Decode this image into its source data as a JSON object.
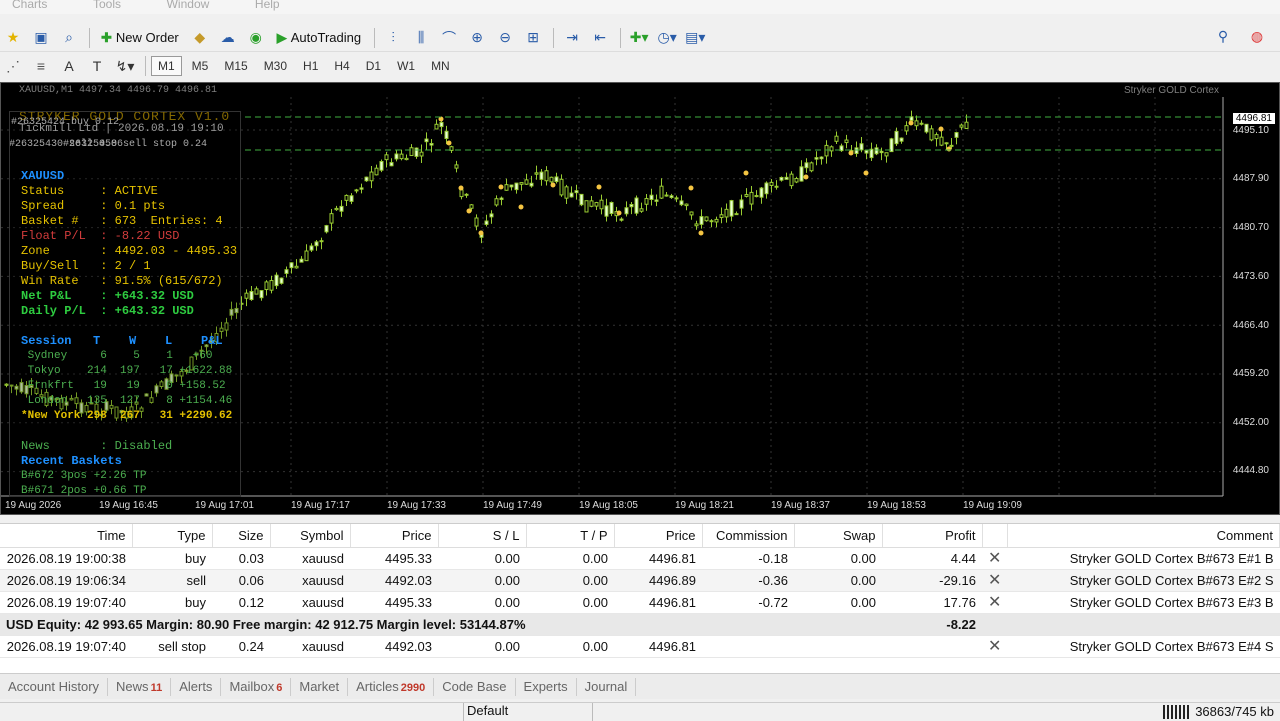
{
  "menu": [
    "Charts",
    "Tools",
    "Window",
    "Help"
  ],
  "toolbar": {
    "new_order": "New Order",
    "autotrading": "AutoTrading",
    "timeframes": [
      "M1",
      "M5",
      "M15",
      "M30",
      "H1",
      "H4",
      "D1",
      "W1",
      "MN"
    ],
    "active_timeframe": "M1"
  },
  "chart": {
    "title": "XAUUSD,M1  4497.34 4496.79 4496.81",
    "ea_name": "Stryker GOLD Cortex",
    "banner": "STRYKER GOLD CORTEX  V1.0",
    "broker": "Tickmill Ltd  |  2026.08.19 19:10",
    "order_labels": [
      "#26325424 buy 0.12",
      "#26325430 sell 0.06",
      "#26325458 sell stop 0.24"
    ],
    "price_ticks": [
      "4495.10",
      "4487.90",
      "4480.70",
      "4473.60",
      "4466.40",
      "4459.20",
      "4452.00",
      "4444.80"
    ],
    "current_price": "4496.81",
    "time_ticks": [
      "19 Aug 2026",
      "19 Aug 16:45",
      "19 Aug 17:01",
      "19 Aug 17:17",
      "19 Aug 17:33",
      "19 Aug 17:49",
      "19 Aug 18:05",
      "19 Aug 18:21",
      "19 Aug 18:37",
      "19 Aug 18:53",
      "19 Aug 19:09"
    ]
  },
  "panel": {
    "symbol": "XAUUSD",
    "status": "Status     : ACTIVE",
    "spread": "Spread     : 0.1 pts",
    "basket": "Basket #   : 673  Entries: 4",
    "float": "Float P/L  : -8.22 USD",
    "zone": "Zone       : 4492.03 - 4495.33",
    "buysell": "Buy/Sell   : 2 / 1",
    "winrate": "Win Rate   : 91.5% (615/672)",
    "netpl": "Net P&L    : +643.32 USD",
    "dailypl": "Daily P/L  : +643.32 USD",
    "session_header": "Session   T    W    L    P&L",
    "sessions": [
      " Sydney     6    5    1   +60",
      " Tokyo    214  197   17 +1622.88",
      " Frnkfrt   19   19    0 +158.52",
      " London   135  127    8 +1154.46",
      "*New York 298  267   31 +2290.62"
    ],
    "news": "News       : Disabled",
    "recent_header": "Recent Baskets",
    "recent": [
      "B#672 3pos +2.26 TP",
      "B#671 2pos +0.66 TP"
    ]
  },
  "trades": {
    "headers": [
      "Time",
      "Type",
      "Size",
      "Symbol",
      "Price",
      "S / L",
      "T / P",
      "Price",
      "Commission",
      "Swap",
      "Profit",
      "",
      "Comment"
    ],
    "rows": [
      [
        "2026.08.19 19:00:38",
        "buy",
        "0.03",
        "xauusd",
        "4495.33",
        "0.00",
        "0.00",
        "4496.81",
        "-0.18",
        "0.00",
        "4.44",
        "✕",
        "Stryker GOLD Cortex B#673 E#1 B"
      ],
      [
        "2026.08.19 19:06:34",
        "sell",
        "0.06",
        "xauusd",
        "4492.03",
        "0.00",
        "0.00",
        "4496.89",
        "-0.36",
        "0.00",
        "-29.16",
        "✕",
        "Stryker GOLD Cortex B#673 E#2 S"
      ],
      [
        "2026.08.19 19:07:40",
        "buy",
        "0.12",
        "xauusd",
        "4495.33",
        "0.00",
        "0.00",
        "4496.81",
        "-0.72",
        "0.00",
        "17.76",
        "✕",
        "Stryker GOLD Cortex B#673 E#3 B"
      ]
    ],
    "summary": "USD  Equity: 42 993.65  Margin: 80.90  Free margin: 42 912.75  Margin level: 53144.87%",
    "summary_profit": "-8.22",
    "pending": [
      "2026.08.19 19:07:40",
      "sell stop",
      "0.24",
      "xauusd",
      "4492.03",
      "0.00",
      "0.00",
      "4496.81",
      "",
      "",
      "",
      "✕",
      "Stryker GOLD Cortex B#673 E#4 S"
    ]
  },
  "tabs": [
    {
      "label": "Account History",
      "badge": ""
    },
    {
      "label": "News",
      "badge": "11"
    },
    {
      "label": "Alerts",
      "badge": ""
    },
    {
      "label": "Mailbox",
      "badge": "6"
    },
    {
      "label": "Market",
      "badge": ""
    },
    {
      "label": "Articles",
      "badge": "2990"
    },
    {
      "label": "Code Base",
      "badge": ""
    },
    {
      "label": "Experts",
      "badge": ""
    },
    {
      "label": "Journal",
      "badge": ""
    }
  ],
  "status": {
    "profile": "Default",
    "traffic": "36863/745 kb"
  }
}
